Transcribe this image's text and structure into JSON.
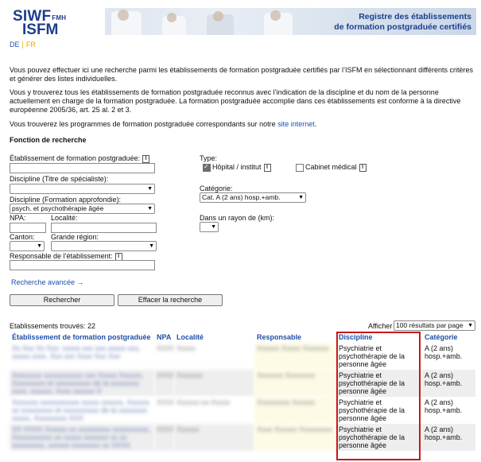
{
  "header": {
    "logo_line1": "SIWF",
    "logo_line1_small": "FMH",
    "logo_line2": "ISFM",
    "banner_title_line1": "Registre des établissements",
    "banner_title_line2": "de formation postgraduée certifiés"
  },
  "lang": {
    "de": "DE",
    "sep": "|",
    "fr": "FR"
  },
  "intro": {
    "p1": "Vous pouvez effectuer ici une recherche parmi les établissements de formation postgraduée certifiés par l’ISFM en sélectionnant différents critères et générer des listes individuelles.",
    "p2": "Vous y trouverez tous les établissements de formation postgraduée reconnus avec l’indication de la discipline et du nom de la personne actuellement en charge de la formation postgraduée. La formation postgraduée accomplie dans ces établissements est conforme à la directive européenne 2005/36, art. 25 al. 2 et 3.",
    "p3_before": "Vous trouverez les programmes de formation postgraduée correspondants sur notre ",
    "p3_link": "site internet",
    "p3_after": "."
  },
  "form": {
    "heading": "Fonction de recherche",
    "etab_label": "Établissement de formation postgraduée:",
    "disc_title_label": "Discipline (Titre de spécialiste):",
    "disc_title_value": "",
    "disc_formation_label": "Discipline (Formation approfondie):",
    "disc_formation_value": "psych. et psychothérapie âgée",
    "npa_label": "NPA:",
    "localite_label": "Localité:",
    "canton_label": "Canton:",
    "region_label": "Grande région:",
    "responsable_label": "Responsable de l’établissement:",
    "type_label": "Type:",
    "type_hopital": "Hôpital / institut",
    "type_hopital_checked": true,
    "type_cabinet": "Cabinet médical",
    "type_cabinet_checked": false,
    "categorie_label": "Catégorie:",
    "categorie_value": "Cat. A (2 ans) hosp.+amb.",
    "rayon_label": "Dans un rayon de (km):",
    "recherche_avancee": "Recherche avancée →",
    "btn_rechercher": "Rechercher",
    "btn_effacer": "Effacer la recherche"
  },
  "results": {
    "count_label": "Etablissements trouvés: 22",
    "afficher_label": "Afficher",
    "afficher_value": "100 résultats par page",
    "columns": [
      "Établissement de formation postgraduée",
      "NPA",
      "Localité",
      "Responsable",
      "Discipline",
      "Catégorie"
    ],
    "rows": [
      {
        "etab": "Xx Xxx Xx Xxx: xxxxx xxx xxx xxxxx xxx, xxxxx xxxx. Xxx xxx Xxxx Xxx Xxx",
        "npa": "XXXX",
        "loc": "Xxxxx",
        "resp": "Xxxxxx Xxxxx Xxxxxxx",
        "disc": "Psychiatrie et psychothérapie de la personne âgée",
        "cat": "A (2 ans) hosp.+amb."
      },
      {
        "etab": "Xxxxxxxx xxxxxxxxxxx xxx Xxxxx Xxxxxx, Xxxxxxxxx et xxxxxxxxxx de la xxxxxxxx xxxx, xxxxxx, Xxxx xxxxxx X",
        "npa": "XXXX",
        "loc": "Xxxxxxx",
        "resp": "Xxxxxxx Xxxxxxxx",
        "disc": "Psychiatrie et psychothérapie de la personne âgée",
        "cat": "A (2 ans) hosp.+amb."
      },
      {
        "etab": "Xxxxxxx xxxxxxxxxxx xxxxx xxxxxx, Xxxxxx xx xxxxxxxxx et xxxxxxxxxx de la xxxxxxxx xxxxx, Xxxxxxxxx XXX",
        "npa": "XXXX",
        "loc": "Xxxxxx-xx-Xxxxx",
        "resp": "Xxxxxxxxx Xxxxxx",
        "disc": "Psychiatrie et psychothérapie de la personne âgée",
        "cat": "A (2 ans) hosp.+amb."
      },
      {
        "etab": "XX XXXX Xxxxxx xx xxxxxxxxx xxxxxxxxxx, Xxxxxxxxxxx xx xxxxx xxxxxxx xx xx xxxxxxxxx, xxxxxx xxxxxxxx xx XXXX",
        "npa": "XXXX",
        "loc": "Xxxxxx",
        "resp": "Xxxx Xxxxxx Xxxxxxxxx",
        "disc": "Psychiatrie et psychothérapie de la personne âgée",
        "cat": "A (2 ans) hosp.+amb."
      }
    ]
  }
}
